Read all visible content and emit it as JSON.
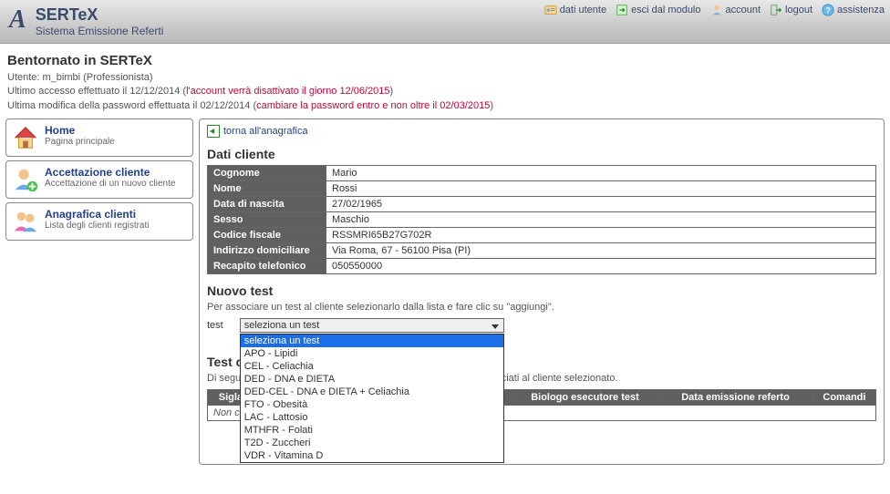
{
  "header": {
    "app_title": "SERTeX",
    "app_subtitle": "Sistema Emissione Referti",
    "nav": {
      "dati_utente": "dati utente",
      "esci_modulo": "esci dal modulo",
      "account": "account",
      "logout": "logout",
      "assistenza": "assistenza"
    }
  },
  "welcome": {
    "title": "Bentornato in SERTeX",
    "user_line": "Utente: m_bimbi (Professionista)",
    "last_access_pre": "Ultimo accesso effettuato il 12/12/2014 (",
    "last_access_warn": "l'account verrà disattivato il giorno 12/06/2015",
    "last_access_post": ")",
    "pwd_line_pre": "Ultima modifica della password effettuata il 02/12/2014 (",
    "pwd_line_warn": "cambiare la password entro e non oltre il 02/03/2015",
    "pwd_line_post": ")"
  },
  "sidebar": {
    "items": [
      {
        "title": "Home",
        "sub": "Pagina principale"
      },
      {
        "title": "Accettazione cliente",
        "sub": "Accettazione di un nuovo cliente"
      },
      {
        "title": "Anagrafica clienti",
        "sub": "Lista degli clienti registrati"
      }
    ]
  },
  "main": {
    "back_label": "torna all'anagrafica",
    "section_client_title": "Dati cliente",
    "client": {
      "cognome_label": "Cognome",
      "cognome": "Mario",
      "nome_label": "Nome",
      "nome": "Rossi",
      "nascita_label": "Data di nascita",
      "nascita": "27/02/1965",
      "sesso_label": "Sesso",
      "sesso": "Maschio",
      "cf_label": "Codice fiscale",
      "cf": "RSSMRI65B27G702R",
      "indirizzo_label": "Indirizzo domiciliare",
      "indirizzo": "Via Roma, 67 - 56100 Pisa (PI)",
      "telefono_label": "Recapito telefonico",
      "telefono": "050550000"
    },
    "section_newtest_title": "Nuovo test",
    "newtest_instr": "Per associare un test al cliente selezionarlo dalla lista e fare clic su \"aggiungi\".",
    "test_label": "test",
    "select_current": "seleziona un test",
    "options": [
      "seleziona un test",
      "APO - Lipidi",
      "CEL - Celiachia",
      "DED - DNA e DIETA",
      "DED-CEL - DNA e DIETA + Celiachia",
      "FTO - Obesità",
      "LAC - Lattosio",
      "MTHFR - Folati",
      "T2D - Zuccheri",
      "VDR - Vitamina D"
    ],
    "section_tests_title": "Test cli",
    "tests_desc_pre": "Di seguito",
    "tests_desc_post": " associati al cliente selezionato.",
    "tests_table": {
      "headers": {
        "sigla": "Sigla",
        "nome": "",
        "biologo": "Biologo esecutore test",
        "data": "Data emissione referto",
        "comandi": "Comandi"
      },
      "empty": "Non ci sono test associati al cliente"
    }
  }
}
